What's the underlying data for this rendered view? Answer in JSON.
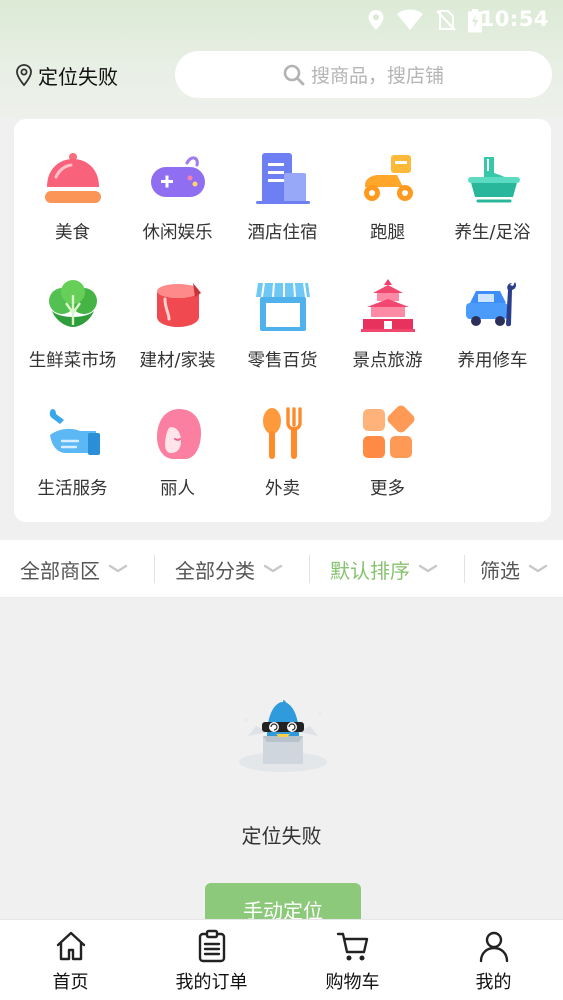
{
  "status_bar": {
    "time": "10:54"
  },
  "header": {
    "location_label": "定位失败",
    "search_placeholder": "搜商品，搜店铺"
  },
  "categories": [
    {
      "label": "美食",
      "icon": "food-cloche-icon"
    },
    {
      "label": "休闲娱乐",
      "icon": "gamepad-icon"
    },
    {
      "label": "酒店住宿",
      "icon": "hotel-building-icon"
    },
    {
      "label": "跑腿",
      "icon": "delivery-scooter-icon"
    },
    {
      "label": "养生/足浴",
      "icon": "foot-bath-icon"
    },
    {
      "label": "生鲜菜市场",
      "icon": "vegetable-icon"
    },
    {
      "label": "建材/家装",
      "icon": "paint-bucket-icon"
    },
    {
      "label": "零售百货",
      "icon": "storefront-icon"
    },
    {
      "label": "景点旅游",
      "icon": "pagoda-icon"
    },
    {
      "label": "养用修车",
      "icon": "car-repair-icon"
    },
    {
      "label": "生活服务",
      "icon": "service-hand-icon"
    },
    {
      "label": "丽人",
      "icon": "beauty-woman-icon"
    },
    {
      "label": "外卖",
      "icon": "spoon-fork-icon"
    },
    {
      "label": "更多",
      "icon": "more-grid-icon"
    }
  ],
  "filters": [
    {
      "label": "全部商区",
      "active": false
    },
    {
      "label": "全部分类",
      "active": false
    },
    {
      "label": "默认排序",
      "active": true
    },
    {
      "label": "筛选",
      "active": false
    }
  ],
  "empty_state": {
    "message": "定位失败",
    "button_label": "手动定位",
    "illustration": "dizzy-mascot-in-box"
  },
  "tabbar": [
    {
      "label": "首页",
      "icon": "home-icon"
    },
    {
      "label": "我的订单",
      "icon": "order-list-icon"
    },
    {
      "label": "购物车",
      "icon": "cart-icon"
    },
    {
      "label": "我的",
      "icon": "user-icon"
    }
  ],
  "colors": {
    "accent": "#86c26f",
    "button": "#8cc97a",
    "background": "#f0f0f0"
  }
}
